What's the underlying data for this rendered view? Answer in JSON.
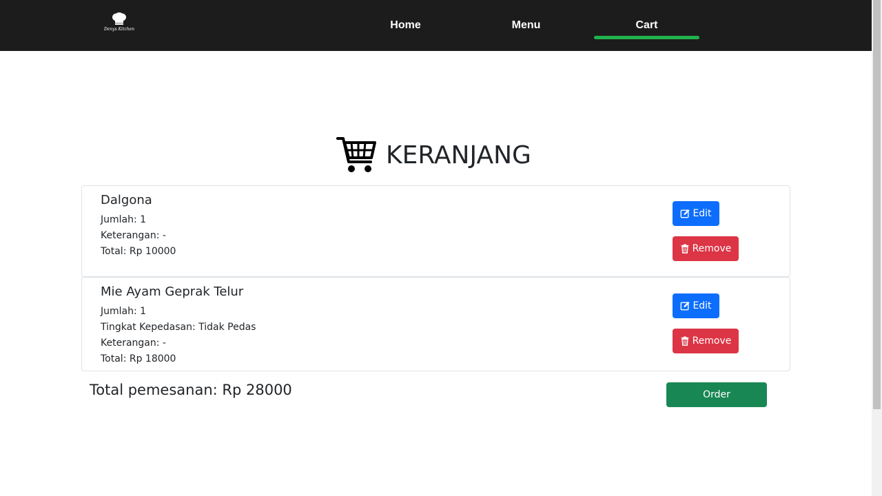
{
  "brand": {
    "logo_text": "Denys Kitchen"
  },
  "nav": {
    "items": [
      {
        "label": "Home"
      },
      {
        "label": "Menu"
      },
      {
        "label": "Cart"
      }
    ],
    "active": "Cart"
  },
  "page": {
    "title": "KERANJANG"
  },
  "cart": {
    "items": [
      {
        "name": "Dalgona",
        "lines": [
          "Jumlah: 1",
          "Keterangan: -",
          "Total: Rp 10000"
        ],
        "edit_label": "Edit",
        "remove_label": "Remove"
      },
      {
        "name": "Mie Ayam Geprak Telur",
        "lines": [
          "Jumlah: 1",
          "Tingkat Kepedasan: Tidak Pedas",
          "Keterangan: -",
          "Total: Rp 18000"
        ],
        "edit_label": "Edit",
        "remove_label": "Remove"
      }
    ],
    "total_label": "Total pemesanan: Rp 28000",
    "order_label": "Order"
  },
  "colors": {
    "navbar": "#1c1c1c",
    "active_indicator": "#22b14c",
    "edit": "#0d6efd",
    "remove": "#dc3545",
    "order": "#198754"
  },
  "icons": [
    "chef-hat-logo",
    "shopping-cart-icon",
    "edit-icon",
    "trash-icon"
  ]
}
